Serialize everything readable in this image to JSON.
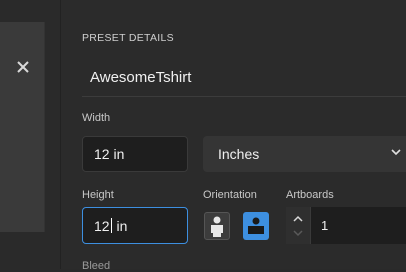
{
  "preset": {
    "section_title": "PRESET DETAILS",
    "name": "AwesomeTshirt"
  },
  "width": {
    "label": "Width",
    "value": "12 in"
  },
  "units": {
    "value": "Inches"
  },
  "height": {
    "label": "Height",
    "value_before_caret": "12",
    "value_after_caret": " in"
  },
  "orientation": {
    "label": "Orientation",
    "selected": "landscape"
  },
  "artboards": {
    "label": "Artboards",
    "value": "1"
  },
  "bleed": {
    "label": "Bleed"
  },
  "colors": {
    "accent": "#3d8fe0",
    "background": "#2b2b2b"
  }
}
